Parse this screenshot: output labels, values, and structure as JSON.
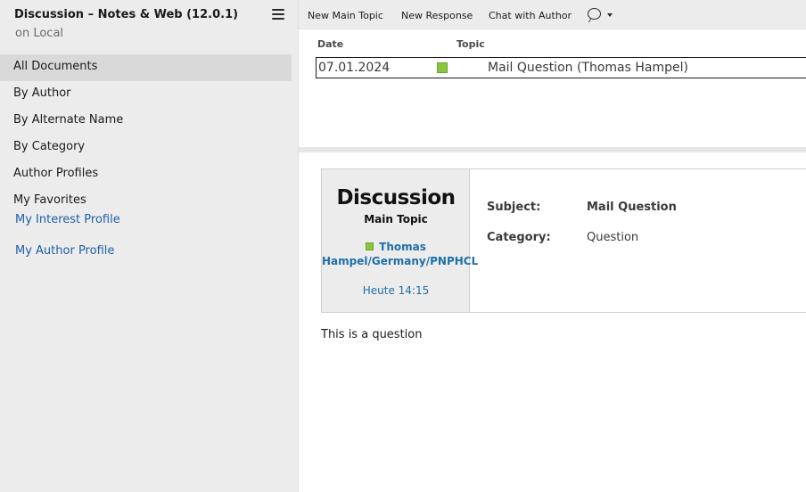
{
  "app": {
    "title": "Discussion – Notes & Web (12.0.1)",
    "subtitle": "on Local"
  },
  "sidebar": {
    "items": [
      {
        "label": "All Documents",
        "selected": true
      },
      {
        "label": "By Author"
      },
      {
        "label": "By Alternate Name"
      },
      {
        "label": "By Category"
      },
      {
        "label": "Author Profiles"
      },
      {
        "label": "My Favorites"
      }
    ],
    "links": [
      {
        "label": "My Interest Profile"
      },
      {
        "label": "My Author Profile"
      }
    ]
  },
  "toolbar": {
    "new_main_topic": "New Main Topic",
    "new_response": "New Response",
    "chat_with_author": "Chat with Author",
    "chat_icon": "chat-bubble-icon"
  },
  "view": {
    "columns": {
      "date": "Date",
      "topic": "Topic"
    },
    "rows": [
      {
        "date": "07.01.2024",
        "topic": "Mail Question (Thomas Hampel)",
        "icon": "document-status-icon",
        "icon_color": "#8cc63f"
      }
    ]
  },
  "document": {
    "form": "Discussion",
    "type": "Main Topic",
    "author": "Thomas Hampel/Germany/PNPHCL",
    "time": "Heute 14:15",
    "fields": {
      "subject_label": "Subject:",
      "subject_value": "Mail Question",
      "category_label": "Category:",
      "category_value": "Question"
    },
    "body": "This is a question"
  },
  "colors": {
    "link": "#1f6fa8",
    "status_green": "#8cc63f",
    "sidebar_bg": "#ececec",
    "selected_bg": "#d9d9d9"
  }
}
